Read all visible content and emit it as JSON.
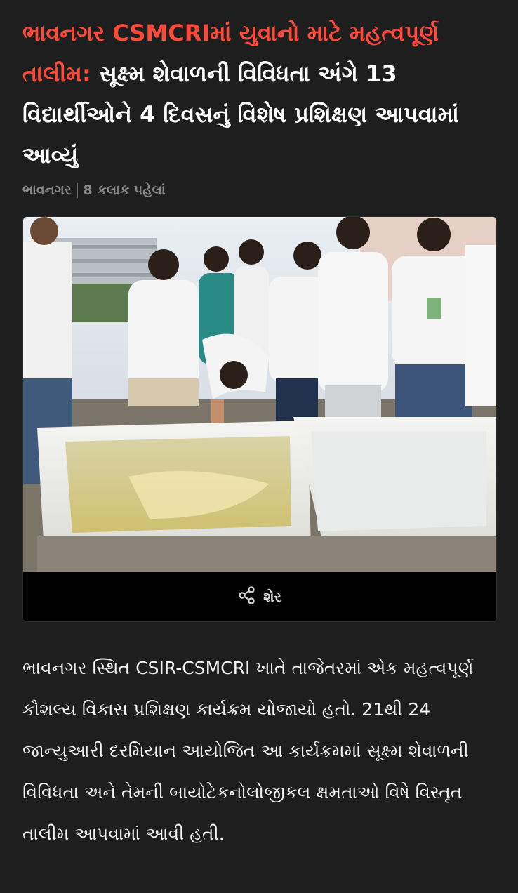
{
  "article": {
    "headline_kicker": "ભાવનગર CSMCRIમાં યુવાનો માટે મહત્વપૂર્ણ તાલીમ:",
    "headline_main": " સૂક્ષ્મ શેવાળની વિવિધતા અંગે 13 વિદ્યાર્થીઓને 4 દિવસનું વિશેષ પ્રશિક્ષણ આપવામાં આવ્યું",
    "location": "ભાવનગર",
    "time_ago": "8 કલાક પહેલાં",
    "share_label": "શેર",
    "body": "ભાવનગર સ્થિત CSIR-CSMCRI ખાતે તાજેતરમાં એક મહત્વપૂર્ણ કૌશલ્ય વિકાસ પ્રશિક્ષણ કાર્યક્રમ યોજાયો હતો. 21થી 24 જાન્યુઆરી દરમિયાન આયોજિત આ કાર્યક્રમમાં સૂક્ષ્મ શેવાળની વિવિધતા અને તેમની બાયોટેકનોલોજીકલ ક્ષમતાઓ વિષે વિસ્તૃત તાલીમ આપવામાં આવી હતી."
  },
  "colors": {
    "background": "#1e1e1e",
    "kicker": "#ff4a3a",
    "text": "#ffffff",
    "meta": "#8a8a8a"
  },
  "icons": {
    "share": "share-icon"
  }
}
